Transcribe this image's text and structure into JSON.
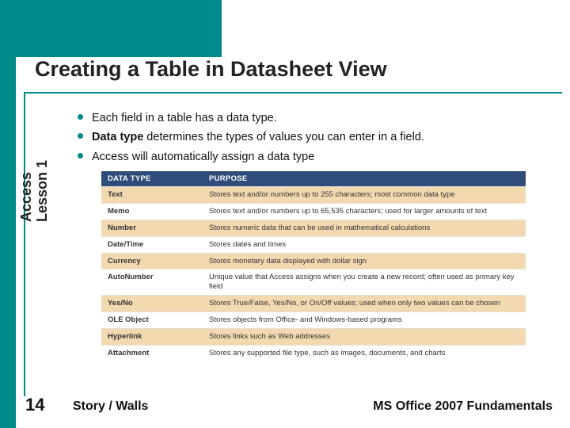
{
  "title": "Creating a Table in Datasheet View",
  "bullets": [
    {
      "text_a": "Each field in a table has a data type."
    },
    {
      "text_a": "",
      "bold": "Data type",
      "text_b": " determines the types of values you can enter in a field."
    },
    {
      "text_a": "Access will automatically assign a data type"
    }
  ],
  "sidebar": {
    "line1": "Access",
    "line2": "Lesson 1"
  },
  "table": {
    "headers": [
      "DATA TYPE",
      "PURPOSE"
    ],
    "rows": [
      {
        "type": "Text",
        "purpose": "Stores text and/or numbers up to 255 characters; most common data type"
      },
      {
        "type": "Memo",
        "purpose": "Stores text and/or numbers up to 65,535 characters; used for larger amounts of text"
      },
      {
        "type": "Number",
        "purpose": "Stores numeric data that can be used in mathematical calculations"
      },
      {
        "type": "Date/Time",
        "purpose": "Stores dates and times"
      },
      {
        "type": "Currency",
        "purpose": "Stores monetary data displayed with dollar sign"
      },
      {
        "type": "AutoNumber",
        "purpose": "Unique value that Access assigns when you create a new record; often used as primary key field"
      },
      {
        "type": "Yes/No",
        "purpose": "Stores True/False, Yes/No, or On/Off values; used when only two values can be chosen"
      },
      {
        "type": "OLE Object",
        "purpose": "Stores objects from Office- and Windows-based programs"
      },
      {
        "type": "Hyperlink",
        "purpose": "Stores links such as Web addresses"
      },
      {
        "type": "Attachment",
        "purpose": "Stores any supported file type, such as images, documents, and charts"
      }
    ]
  },
  "footer": {
    "slide_number": "14",
    "left": "Story / Walls",
    "right": "MS Office 2007 Fundamentals"
  }
}
